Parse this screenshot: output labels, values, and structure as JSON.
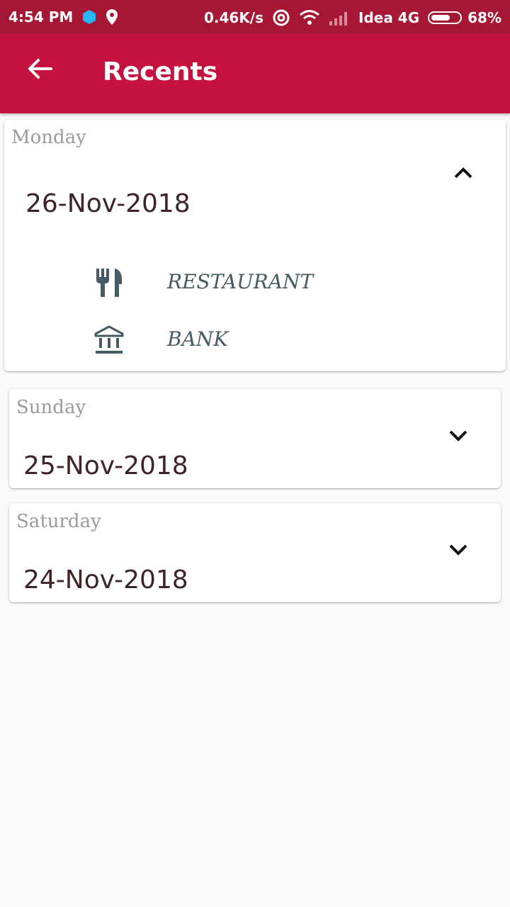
{
  "status_bar": {
    "time": "4:54 PM",
    "speed": "0.46K/s",
    "carrier": "Idea 4G",
    "battery": "68%",
    "battery_level": 0.68,
    "icons": [
      "app-bubble-icon",
      "location-pin-icon",
      "hotspot-icon",
      "wifi-icon",
      "signal-icon",
      "battery-icon"
    ]
  },
  "app_bar": {
    "title": "Recents",
    "back_icon": "arrow-back-icon"
  },
  "colors": {
    "status_bar": "#a61734",
    "app_bar": "#c5123e",
    "background": "#fafafa",
    "day_text": "#9b9b9b",
    "date_text": "#3e2427",
    "item_text": "#455a64"
  },
  "groups": [
    {
      "day": "Monday",
      "date": "26-Nov-2018",
      "expanded": true,
      "items": [
        {
          "label": "RESTAURANT",
          "icon": "restaurant-icon"
        },
        {
          "label": "BANK",
          "icon": "bank-icon"
        }
      ]
    },
    {
      "day": "Sunday",
      "date": "25-Nov-2018",
      "expanded": false,
      "items": []
    },
    {
      "day": "Saturday",
      "date": "24-Nov-2018",
      "expanded": false,
      "items": []
    }
  ]
}
